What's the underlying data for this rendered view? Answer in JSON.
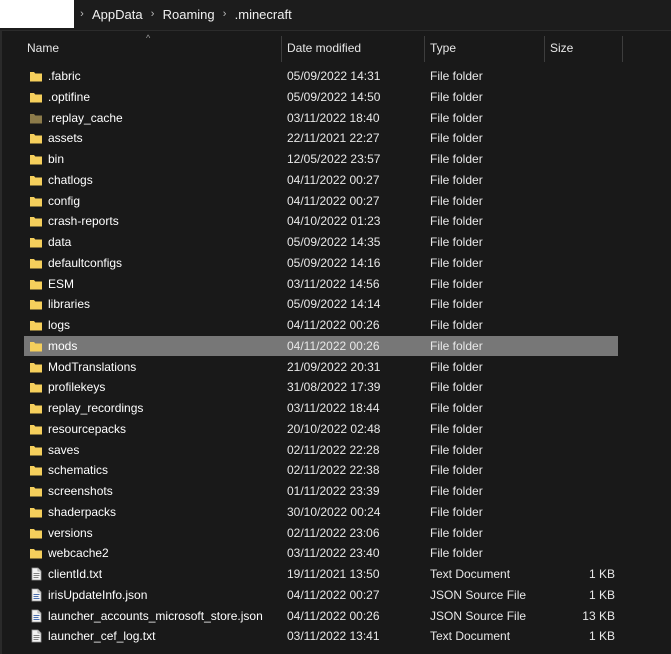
{
  "breadcrumb": {
    "items": [
      "AppData",
      "Roaming",
      ".minecraft"
    ]
  },
  "columns": {
    "name": "Name",
    "date": "Date modified",
    "type": "Type",
    "size": "Size"
  },
  "colors": {
    "folder": "#f5cf5c",
    "folder_dim": "#8c7b4a",
    "selection": "#777777",
    "background": "#191919"
  },
  "files": [
    {
      "name": ".fabric",
      "date": "05/09/2022 14:31",
      "type": "File folder",
      "size": "",
      "icon": "folder-icon"
    },
    {
      "name": ".optifine",
      "date": "05/09/2022 14:50",
      "type": "File folder",
      "size": "",
      "icon": "folder-icon"
    },
    {
      "name": ".replay_cache",
      "date": "03/11/2022 18:40",
      "type": "File folder",
      "size": "",
      "icon": "hidden-folder-icon"
    },
    {
      "name": "assets",
      "date": "22/11/2021 22:27",
      "type": "File folder",
      "size": "",
      "icon": "folder-icon"
    },
    {
      "name": "bin",
      "date": "12/05/2022 23:57",
      "type": "File folder",
      "size": "",
      "icon": "folder-icon"
    },
    {
      "name": "chatlogs",
      "date": "04/11/2022 00:27",
      "type": "File folder",
      "size": "",
      "icon": "folder-icon"
    },
    {
      "name": "config",
      "date": "04/11/2022 00:27",
      "type": "File folder",
      "size": "",
      "icon": "folder-icon"
    },
    {
      "name": "crash-reports",
      "date": "04/10/2022 01:23",
      "type": "File folder",
      "size": "",
      "icon": "folder-icon"
    },
    {
      "name": "data",
      "date": "05/09/2022 14:35",
      "type": "File folder",
      "size": "",
      "icon": "folder-icon"
    },
    {
      "name": "defaultconfigs",
      "date": "05/09/2022 14:16",
      "type": "File folder",
      "size": "",
      "icon": "folder-icon"
    },
    {
      "name": "ESM",
      "date": "03/11/2022 14:56",
      "type": "File folder",
      "size": "",
      "icon": "folder-icon"
    },
    {
      "name": "libraries",
      "date": "05/09/2022 14:14",
      "type": "File folder",
      "size": "",
      "icon": "folder-icon"
    },
    {
      "name": "logs",
      "date": "04/11/2022 00:26",
      "type": "File folder",
      "size": "",
      "icon": "folder-icon"
    },
    {
      "name": "mods",
      "date": "04/11/2022 00:26",
      "type": "File folder",
      "size": "",
      "icon": "folder-icon",
      "selected": true
    },
    {
      "name": "ModTranslations",
      "date": "21/09/2022 20:31",
      "type": "File folder",
      "size": "",
      "icon": "folder-icon"
    },
    {
      "name": "profilekeys",
      "date": "31/08/2022 17:39",
      "type": "File folder",
      "size": "",
      "icon": "folder-icon"
    },
    {
      "name": "replay_recordings",
      "date": "03/11/2022 18:44",
      "type": "File folder",
      "size": "",
      "icon": "folder-icon"
    },
    {
      "name": "resourcepacks",
      "date": "20/10/2022 02:48",
      "type": "File folder",
      "size": "",
      "icon": "folder-icon"
    },
    {
      "name": "saves",
      "date": "02/11/2022 22:28",
      "type": "File folder",
      "size": "",
      "icon": "folder-icon"
    },
    {
      "name": "schematics",
      "date": "02/11/2022 22:38",
      "type": "File folder",
      "size": "",
      "icon": "folder-icon"
    },
    {
      "name": "screenshots",
      "date": "01/11/2022 23:39",
      "type": "File folder",
      "size": "",
      "icon": "folder-icon"
    },
    {
      "name": "shaderpacks",
      "date": "30/10/2022 00:24",
      "type": "File folder",
      "size": "",
      "icon": "folder-icon"
    },
    {
      "name": "versions",
      "date": "02/11/2022 23:06",
      "type": "File folder",
      "size": "",
      "icon": "folder-icon"
    },
    {
      "name": "webcache2",
      "date": "03/11/2022 23:40",
      "type": "File folder",
      "size": "",
      "icon": "folder-icon"
    },
    {
      "name": "clientId.txt",
      "date": "19/11/2021 13:50",
      "type": "Text Document",
      "size": "1 KB",
      "icon": "text-file-icon"
    },
    {
      "name": "irisUpdateInfo.json",
      "date": "04/11/2022 00:27",
      "type": "JSON Source File",
      "size": "1 KB",
      "icon": "json-file-icon"
    },
    {
      "name": "launcher_accounts_microsoft_store.json",
      "date": "04/11/2022 00:26",
      "type": "JSON Source File",
      "size": "13 KB",
      "icon": "json-file-icon"
    },
    {
      "name": "launcher_cef_log.txt",
      "date": "03/11/2022 13:41",
      "type": "Text Document",
      "size": "1 KB",
      "icon": "text-file-icon"
    }
  ]
}
